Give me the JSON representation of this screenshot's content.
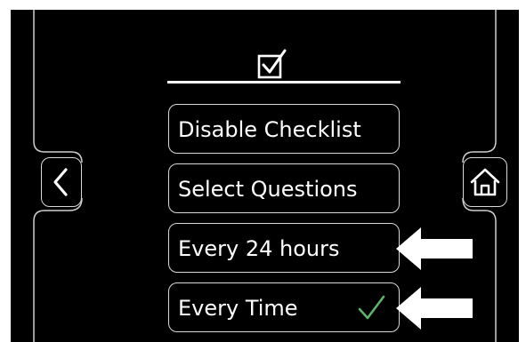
{
  "header": {
    "icon": "checkbox-checked-icon"
  },
  "menu": {
    "items": [
      {
        "label": "Disable Checklist",
        "selected": false
      },
      {
        "label": "Select Questions",
        "selected": false
      },
      {
        "label": "Every 24 hours",
        "selected": false
      },
      {
        "label": "Every Time",
        "selected": true
      }
    ]
  },
  "nav": {
    "back_icon": "chevron-left-icon",
    "home_icon": "home-icon"
  },
  "annotations": {
    "arrow_icon": "white-arrow-left-icon"
  },
  "colors": {
    "background": "#000000",
    "foreground": "#ffffff",
    "button_border": "#d8d8d8",
    "check_green": "#5fb36b"
  }
}
